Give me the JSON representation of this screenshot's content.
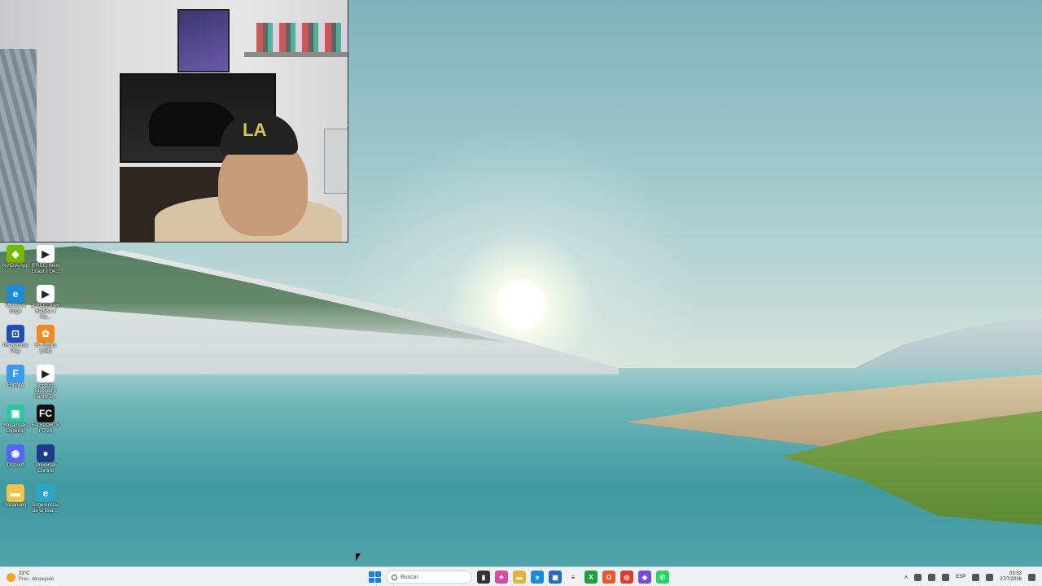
{
  "webcam": {
    "cap_text": "LA"
  },
  "desktop_icons": [
    {
      "id": "nvidia-app",
      "label": "NVIDIA App",
      "color": "#76b900",
      "glyph": "◆"
    },
    {
      "id": "free-west-coast",
      "label": "[FREE] West Coast x De...",
      "color": "#ffffff",
      "glyph": "▶"
    },
    {
      "id": "microsoft-edge",
      "label": "Microsoft Edge",
      "color": "#1b8adb",
      "glyph": "e"
    },
    {
      "id": "free-bossa",
      "label": "[FREE] Joey Badass x Ra...",
      "color": "#ffffff",
      "glyph": "▶"
    },
    {
      "id": "ps-remote-play",
      "label": "PS Remote Play",
      "color": "#1f4fb5",
      "glyph": "⊡"
    },
    {
      "id": "fl-studio",
      "label": "FL Studio (x64)",
      "color": "#f08a1c",
      "glyph": "✿"
    },
    {
      "id": "fortnite",
      "label": "Fortnite",
      "color": "#3a9ae8",
      "glyph": "F"
    },
    {
      "id": "free-blessed",
      "label": "[FREE] Blessed x Kenny D...",
      "color": "#ffffff",
      "glyph": "▶"
    },
    {
      "id": "streamlabs",
      "label": "Streamlabs Desktop",
      "color": "#31c3a2",
      "glyph": "▣"
    },
    {
      "id": "ea-sports-fc",
      "label": "EA SPORTS FC 26",
      "color": "#111111",
      "glyph": "FC"
    },
    {
      "id": "discord",
      "label": "Discord",
      "color": "#5865f2",
      "glyph": "◉"
    },
    {
      "id": "universal-control",
      "label": "Universal Control",
      "color": "#1d3b8a",
      "glyph": "●"
    },
    {
      "id": "nananana-folder",
      "label": "nananaeq",
      "color": "#f2c24b",
      "glyph": "▬"
    },
    {
      "id": "sugerencias",
      "label": "Sugerencias de la lista ...",
      "color": "#2aa6c8",
      "glyph": "e"
    }
  ],
  "taskbar": {
    "weather_temp": "23°C",
    "weather_desc": "Prac. despejado",
    "search_placeholder": "Buscar",
    "apps": [
      {
        "id": "task-view",
        "glyph": "▮",
        "color": "#333333"
      },
      {
        "id": "copilot",
        "glyph": "✦",
        "color": "#d24fa0"
      },
      {
        "id": "file-explorer",
        "glyph": "▬",
        "color": "#e3b341"
      },
      {
        "id": "edge",
        "glyph": "e",
        "color": "#1b8adb"
      },
      {
        "id": "store",
        "glyph": "▦",
        "color": "#2467c4"
      },
      {
        "id": "notepad",
        "glyph": "≡",
        "color": "#f2f2f2"
      },
      {
        "id": "xbox",
        "glyph": "X",
        "color": "#1f9e3a"
      },
      {
        "id": "office",
        "glyph": "O",
        "color": "#e8582b"
      },
      {
        "id": "chrome",
        "glyph": "◎",
        "color": "#d93f2f"
      },
      {
        "id": "messenger",
        "glyph": "◆",
        "color": "#7b4bd8"
      },
      {
        "id": "whatsapp",
        "glyph": "✆",
        "color": "#25d366"
      }
    ],
    "tray_language": "ESP",
    "clock_time": "03:53",
    "clock_date": "27/7/2026"
  }
}
